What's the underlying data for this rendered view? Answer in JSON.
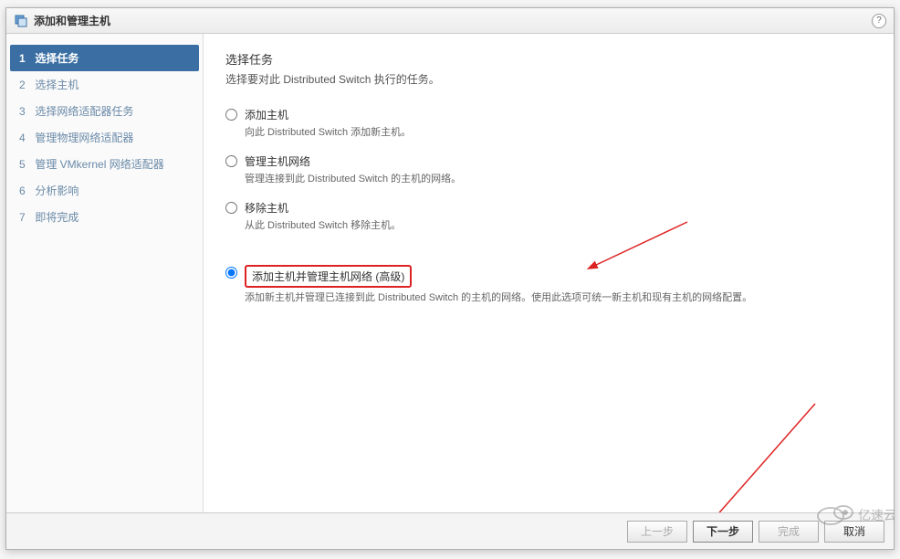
{
  "dialog": {
    "title": "添加和管理主机"
  },
  "sidebar": {
    "steps": [
      {
        "num": "1",
        "label": "选择任务"
      },
      {
        "num": "2",
        "label": "选择主机"
      },
      {
        "num": "3",
        "label": "选择网络适配器任务"
      },
      {
        "num": "4",
        "label": "管理物理网络适配器"
      },
      {
        "num": "5",
        "label": "管理 VMkernel 网络适配器"
      },
      {
        "num": "6",
        "label": "分析影响"
      },
      {
        "num": "7",
        "label": "即将完成"
      }
    ]
  },
  "content": {
    "heading": "选择任务",
    "subtitle": "选择要对此 Distributed Switch 执行的任务。",
    "options": [
      {
        "label": "添加主机",
        "desc": "向此 Distributed Switch 添加新主机。",
        "selected": false
      },
      {
        "label": "管理主机网络",
        "desc": "管理连接到此 Distributed Switch 的主机的网络。",
        "selected": false
      },
      {
        "label": "移除主机",
        "desc": "从此 Distributed Switch 移除主机。",
        "selected": false
      },
      {
        "label": "添加主机并管理主机网络 (高级)",
        "desc": "添加新主机并管理已连接到此 Distributed Switch 的主机的网络。使用此选项可统一新主机和现有主机的网络配置。",
        "selected": true
      }
    ]
  },
  "footer": {
    "back": "上一步",
    "next": "下一步",
    "finish": "完成",
    "cancel": "取消"
  },
  "watermark": "亿速云"
}
